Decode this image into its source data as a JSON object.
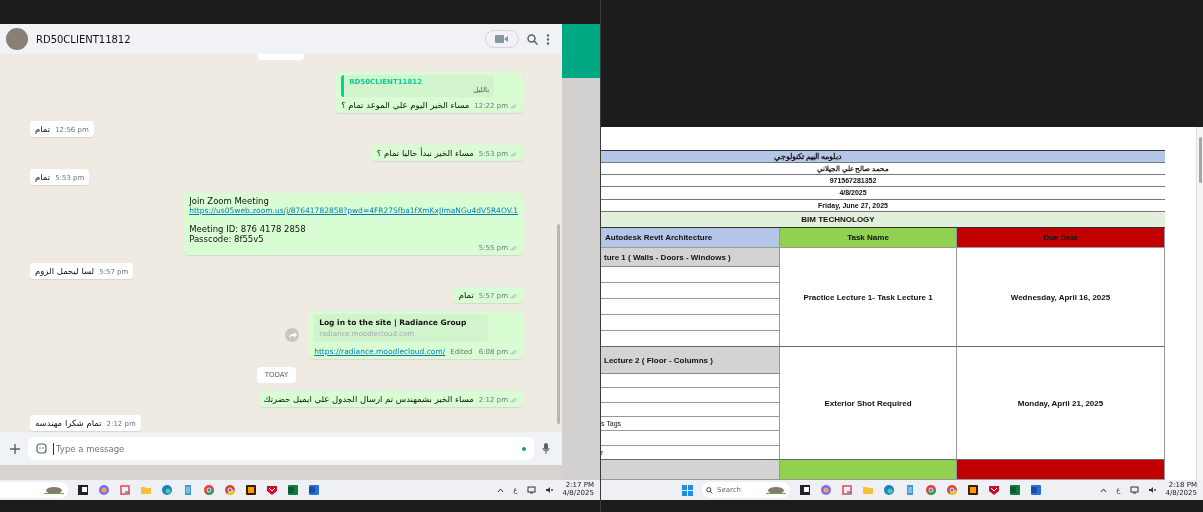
{
  "left_screen": {
    "chat": {
      "contact_name": "RD50CLIENT11812",
      "messages": [
        {
          "kind": "quote",
          "outgoing": true,
          "quote_author": "RD50CLIENT11812",
          "quote_text": "بالليل",
          "text": "مساء الخير اليوم علي الموعد تمام ؟",
          "time": "12:22 pm"
        },
        {
          "kind": "text",
          "outgoing": false,
          "text": "تمام",
          "time": "12:56 pm"
        },
        {
          "kind": "text",
          "outgoing": true,
          "text": "مساء الخير نبدأ حاليا تمام ؟",
          "time": "5:53 pm"
        },
        {
          "kind": "text",
          "outgoing": false,
          "text": "تمام",
          "time": "5:53 pm"
        },
        {
          "kind": "zoom",
          "outgoing": true,
          "title": "Join Zoom Meeting",
          "link": "https://us05web.zoom.us/j/87641782858?pwd=4FR27Sfba1fXmKxJImaNGu4dV5R4OV.1",
          "details": [
            "Meeting ID: 876 4178 2858",
            "Passcode: 8f55v5"
          ],
          "time": "5:55 pm"
        },
        {
          "kind": "text",
          "outgoing": false,
          "text": "لسا ليحمل الزوم",
          "time": "5:57 pm"
        },
        {
          "kind": "text",
          "outgoing": true,
          "text": "تمام",
          "time": "5:57 pm"
        },
        {
          "kind": "preview",
          "outgoing": true,
          "preview_title": "Log in to the site | Radiance Group",
          "preview_domain": "radiance.moodlecloud.com",
          "link": "https://radiance.moodlecloud.com/",
          "edited": "Edited",
          "time": "6:08 pm"
        },
        {
          "kind": "date",
          "text": "TODAY"
        },
        {
          "kind": "text",
          "outgoing": true,
          "text": "مساء الخير بشمهندس تم ارسال الجدول علي ايميل حضرتك",
          "time": "2:12 pm"
        },
        {
          "kind": "text",
          "outgoing": false,
          "text": "تمام شكرا مهندسه",
          "time": "2:12 pm"
        }
      ],
      "composer": {
        "placeholder": "Type a message"
      }
    },
    "taskbar": {
      "input_indicator": "ع",
      "time": "2:17 PM",
      "date": "4/8/2025"
    }
  },
  "right_screen": {
    "sheet": {
      "top_rows": [
        {
          "kind": "title",
          "text": "دبلومه البيم تكنولوجي"
        },
        {
          "kind": "plain",
          "text": "محمد صالح علي الجيلاني"
        },
        {
          "kind": "plain",
          "text": "971567281352"
        },
        {
          "kind": "plain",
          "text": "4/8/2025"
        },
        {
          "kind": "plain",
          "text": "Friday, June 27, 2025"
        },
        {
          "kind": "section",
          "text": "BIM TECHNOLOGY"
        }
      ],
      "columns": [
        {
          "label": "Autodesk Revit Architecture",
          "color": "#b4c6e7"
        },
        {
          "label": "Task Name",
          "color": "#92d050"
        },
        {
          "label": "Due Date",
          "color": "#c00000"
        }
      ],
      "lectures": [
        {
          "title": "ture 1 ( Walls - Doors - Windows )",
          "task": "Practice Lecture 1-   Task Lecture 1",
          "due": "Wednesday, April 16, 2025",
          "rows": [
            {
              "kind": "blank"
            },
            {
              "kind": "blank"
            },
            {
              "kind": "blank"
            },
            {
              "kind": "blank"
            },
            {
              "kind": "blank"
            }
          ]
        },
        {
          "title": "Lecture 2 ( Floor - Columns )",
          "task": "Exterior Shot Required",
          "due": "Monday, April 21, 2025",
          "rows": [
            {
              "kind": "blank"
            },
            {
              "kind": "blank"
            },
            {
              "kind": "blank"
            },
            {
              "kind": "text",
              "text": "s Tags"
            },
            {
              "kind": "blank"
            },
            {
              "kind": "text",
              "text": "r"
            }
          ]
        }
      ]
    },
    "taskbar": {
      "search_placeholder": "Search",
      "input_indicator": "ع",
      "time": "2:18 PM",
      "date": "4/8/2025"
    }
  }
}
